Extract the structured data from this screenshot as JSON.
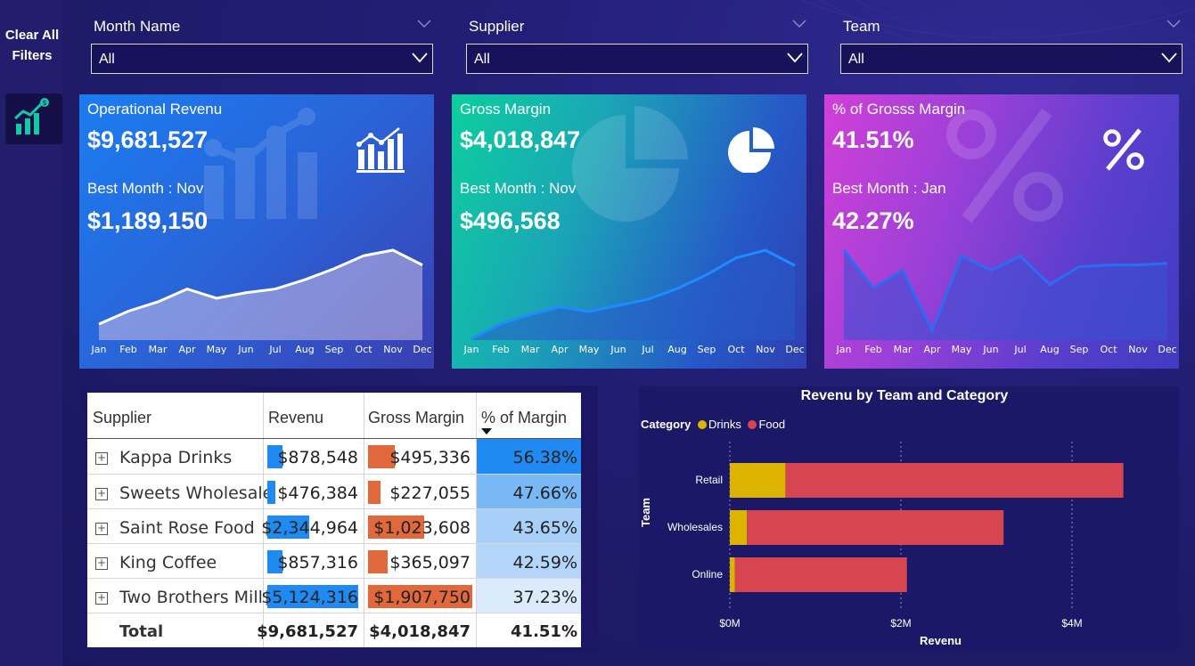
{
  "sidebar": {
    "clear_label_line1": "Clear All",
    "clear_label_line2": "Filters",
    "icon": "revenue-chart-icon"
  },
  "slicers": [
    {
      "label": "Month Name",
      "value": "All"
    },
    {
      "label": "Supplier",
      "value": "All"
    },
    {
      "label": "Team",
      "value": "All"
    }
  ],
  "cards": [
    {
      "title": "Operational Revenu",
      "value": "$9,681,527",
      "best_label": "Best Month : Nov",
      "best_value": "$1,189,150",
      "icon": "bar-chart-icon",
      "trend": [
        88,
        95,
        100,
        107,
        102,
        105,
        107,
        112,
        118,
        125,
        128,
        120
      ]
    },
    {
      "title": "Gross Margin",
      "value": "$4,018,847",
      "best_label": "Best Month : Nov",
      "best_value": "$496,568",
      "icon": "pie-chart-icon",
      "trend": [
        40,
        50,
        56,
        61,
        58,
        62,
        66,
        73,
        82,
        93,
        98,
        88
      ]
    },
    {
      "title": "% of Grosss Margin",
      "value": "41.51%",
      "best_label": "Best Month : Jan",
      "best_value": "42.27%",
      "icon": "percent-icon",
      "trend": [
        42.27,
        41.2,
        41.7,
        40.0,
        42.1,
        41.7,
        42.1,
        41.3,
        41.8,
        41.85,
        41.85,
        41.9
      ]
    }
  ],
  "months": [
    "Jan",
    "Feb",
    "Mar",
    "Apr",
    "May",
    "Jun",
    "Jul",
    "Aug",
    "Sep",
    "Oct",
    "Nov",
    "Dec"
  ],
  "table": {
    "headers": [
      "Supplier",
      "Revenu",
      "Gross Margin",
      "% of Margin"
    ],
    "rows": [
      {
        "supplier": "Kappa Drinks",
        "revenu": "$878,548",
        "margin": "$495,336",
        "pct": "56.38%",
        "rev_frac": 0.17,
        "mar_frac": 0.26,
        "pct_color": "#1f8af1"
      },
      {
        "supplier": "Sweets Wholesale",
        "revenu": "$476,384",
        "margin": "$227,055",
        "pct": "47.66%",
        "rev_frac": 0.09,
        "mar_frac": 0.12,
        "pct_color": "#7ab8f5"
      },
      {
        "supplier": "Saint Rose Food",
        "revenu": "$2,344,964",
        "margin": "$1,023,608",
        "pct": "43.65%",
        "rev_frac": 0.46,
        "mar_frac": 0.54,
        "pct_color": "#a8cff8"
      },
      {
        "supplier": "King Coffee",
        "revenu": "$857,316",
        "margin": "$365,097",
        "pct": "42.59%",
        "rev_frac": 0.17,
        "mar_frac": 0.19,
        "pct_color": "#b3d5f9"
      },
      {
        "supplier": "Two Brothers Mill",
        "revenu": "$5,124,316",
        "margin": "$1,907,750",
        "pct": "37.23%",
        "rev_frac": 1.0,
        "mar_frac": 1.0,
        "pct_color": "#dbeafc"
      }
    ],
    "total": {
      "label": "Total",
      "revenu": "$9,681,527",
      "margin": "$4,018,847",
      "pct": "41.51%"
    }
  },
  "chart_data": {
    "type": "bar",
    "title": "Revenu by Team and Category",
    "legend_title": "Category",
    "xlabel": "Revenu",
    "ylabel": "Team",
    "categories": [
      "Retail",
      "Wholesales",
      "Online"
    ],
    "series": [
      {
        "name": "Drinks",
        "color": "#dcb400",
        "values": [
          0.65,
          0.2,
          0.06
        ]
      },
      {
        "name": "Food",
        "color": "#d64550",
        "values": [
          3.95,
          3.0,
          2.01
        ]
      }
    ],
    "xlim": [
      0,
      4.8
    ],
    "xticks": [
      0,
      2,
      4
    ],
    "xtick_labels": [
      "$0M",
      "$2M",
      "$4M"
    ]
  }
}
